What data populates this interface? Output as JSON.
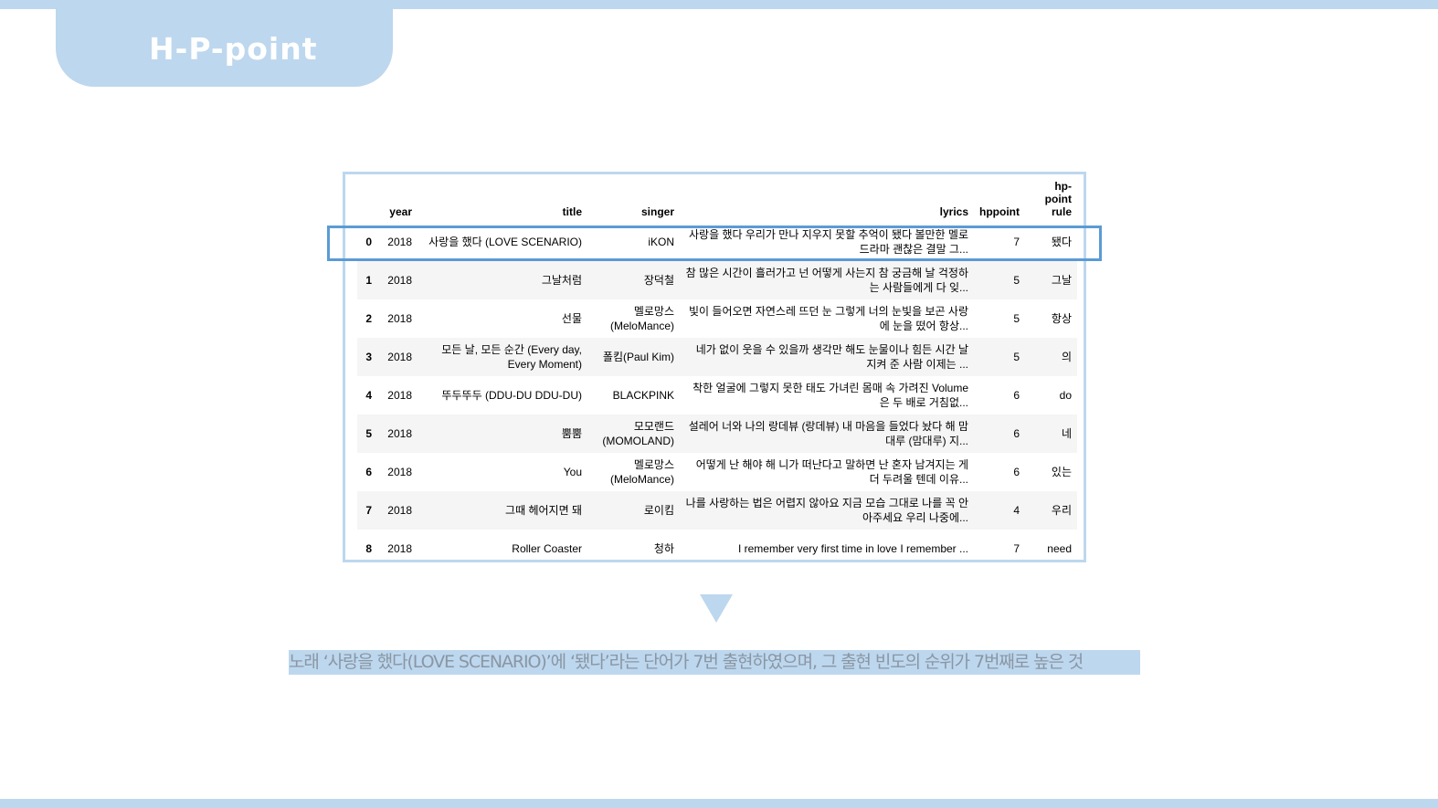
{
  "slide": {
    "title": "H-P-point",
    "caption": "노래 ‘사랑을 했다(LOVE SCENARIO)’에 ‘됐다’라는 단어가 7번 출현하였으며, 그 출현 빈도의 순위가 7번째로 높은 것"
  },
  "table": {
    "headers": {
      "index": "",
      "year": "year",
      "title": "title",
      "singer": "singer",
      "lyrics": "lyrics",
      "hppoint": "hppoint",
      "rule": "hp-\npoint\nrule"
    },
    "rows": [
      {
        "index": "0",
        "year": "2018",
        "title": "사랑을 했다 (LOVE SCENARIO)",
        "singer": "iKON",
        "lyrics": "사랑을 했다 우리가 만나 지우지 못할 추억이 됐다 볼만한 멜로드라마 괜찮은 결말 그...",
        "hppoint": "7",
        "rule": "됐다"
      },
      {
        "index": "1",
        "year": "2018",
        "title": "그날처럼",
        "singer": "장덕철",
        "lyrics": "참 많은 시간이 흘러가고 넌 어떻게 사는지 참 궁금해 날 걱정하는 사람들에게 다 잊...",
        "hppoint": "5",
        "rule": "그날"
      },
      {
        "index": "2",
        "year": "2018",
        "title": "선물",
        "singer": "멜로망스 (MeloMance)",
        "lyrics": "빛이 들어오면 자연스레 뜨던 눈 그렇게 너의 눈빛을 보곤 사랑에 눈을 떴어 항상...",
        "hppoint": "5",
        "rule": "항상"
      },
      {
        "index": "3",
        "year": "2018",
        "title": "모든 날, 모든 순간 (Every day, Every Moment)",
        "singer": "폴킴(Paul Kim)",
        "lyrics": "네가 없이 웃을 수 있을까 생각만 해도 눈물이나 힘든 시간 날 지켜 준 사람 이제는 ...",
        "hppoint": "5",
        "rule": "의"
      },
      {
        "index": "4",
        "year": "2018",
        "title": "뚜두뚜두 (DDU-DU DDU-DU)",
        "singer": "BLACKPINK",
        "lyrics": "착한 얼굴에 그렇지 못한 태도 가녀린 몸매 속 가려진 Volume은 두 배로 거침없...",
        "hppoint": "6",
        "rule": "do"
      },
      {
        "index": "5",
        "year": "2018",
        "title": "뿜뿜",
        "singer": "모모랜드 (MOMOLAND)",
        "lyrics": "설레어 너와 나의 랑데뷰 (랑데뷰) 내 마음을 들었다 놨다 해 맘대루 (맘대루) 지...",
        "hppoint": "6",
        "rule": "네"
      },
      {
        "index": "6",
        "year": "2018",
        "title": "You",
        "singer": "멜로망스 (MeloMance)",
        "lyrics": "어떻게 난 해야 해 니가 떠난다고 말하면 난 혼자 남겨지는 게 더 두려울 텐데 이유...",
        "hppoint": "6",
        "rule": "있는"
      },
      {
        "index": "7",
        "year": "2018",
        "title": "그때 헤어지면 돼",
        "singer": "로이킴",
        "lyrics": "나를 사랑하는 법은 어렵지 않아요 지금 모습 그대로 나를 꼭 안아주세요 우리 나중에...",
        "hppoint": "4",
        "rule": "우리"
      },
      {
        "index": "8",
        "year": "2018",
        "title": "Roller Coaster",
        "singer": "청하",
        "lyrics": "I remember very first time in love I remember ...",
        "hppoint": "7",
        "rule": "need"
      }
    ]
  },
  "colors": {
    "accent_light": "#bdd7ee",
    "highlight_border": "#5b9bd5",
    "caption_text": "#8a96a3"
  }
}
